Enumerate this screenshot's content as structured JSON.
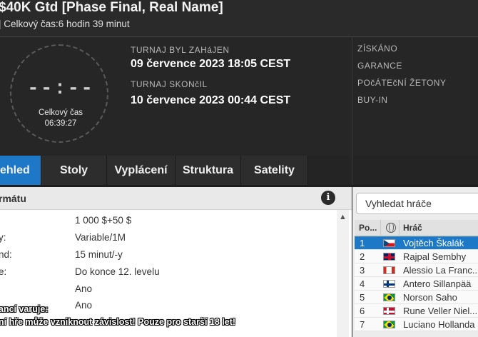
{
  "header": {
    "title": "$40K Gtd [Phase Final, Real Name]",
    "subtitle": "| Celkový čas:6 hodin  39 minut"
  },
  "clock": {
    "digits": "--:--",
    "label": "Celkový čas",
    "time": "06:39:27"
  },
  "info": {
    "started_label": "TURNAJ BYL ZAHáJEN",
    "started_value": "09 července 2023   18:05 CEST",
    "ended_label": "TURNAJ SKONčIL",
    "ended_value": "10 července 2023   00:44 CEST",
    "right_labels": [
      "ZÍSKÁNO",
      "GARANCE",
      "POčÁTEčNÍ ŽETONY",
      "BUY-IN"
    ]
  },
  "tabs": [
    {
      "label": "ehled",
      "active": true
    },
    {
      "label": "Stoly",
      "active": false
    },
    {
      "label": "Vyplácení",
      "active": false
    },
    {
      "label": "Struktura",
      "active": false
    },
    {
      "label": "Satelity",
      "active": false
    }
  ],
  "details": {
    "header_title": "rmátu",
    "info_icon": "i",
    "rows": [
      {
        "key": "",
        "value": "1 000 $+50 $"
      },
      {
        "key": "y:",
        "value": "Variable/1M"
      },
      {
        "key": "nd:",
        "value": "15 minut/-y"
      },
      {
        "key": "e:",
        "value": "Do konce 12. levelu"
      },
      {
        "key": "",
        "value": "Ano"
      },
      {
        "key": "",
        "value": "Ano"
      }
    ],
    "warning_line1": "ancí varuje:",
    "warning_line2": "ní hře může vzniknout závislost! Pouze pro starší 18 let!"
  },
  "players": {
    "search_placeholder": "Vyhledat hráče",
    "col_pos": "Po...",
    "col_player": "Hráč",
    "rows": [
      {
        "pos": "1",
        "name": "Vojtěch Škalák",
        "flag": "cz",
        "selected": true
      },
      {
        "pos": "2",
        "name": "Rajpal Sembhy",
        "flag": "gb",
        "selected": false
      },
      {
        "pos": "3",
        "name": "Alessio La Franc...",
        "flag": "ca",
        "selected": false
      },
      {
        "pos": "4",
        "name": "Antero Sillanpää",
        "flag": "fi",
        "selected": false
      },
      {
        "pos": "5",
        "name": "Norson Saho",
        "flag": "br",
        "selected": false
      },
      {
        "pos": "6",
        "name": "Rune Veller Niel...",
        "flag": "dk",
        "selected": false
      },
      {
        "pos": "7",
        "name": "Luciano Hollanda",
        "flag": "br",
        "selected": false
      }
    ]
  },
  "colors": {
    "accent": "#1e78c8",
    "background": "#1e1e1e"
  }
}
